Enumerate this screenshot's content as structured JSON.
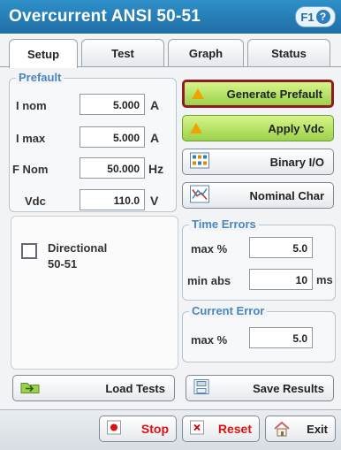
{
  "window": {
    "title": "Overcurrent ANSI 50-51",
    "help_label": "F1"
  },
  "tabs": [
    {
      "label": "Setup",
      "active": true
    },
    {
      "label": "Test",
      "active": false
    },
    {
      "label": "Graph",
      "active": false
    },
    {
      "label": "Status",
      "active": false
    }
  ],
  "prefault": {
    "legend": "Prefault",
    "rows": [
      {
        "label": "I nom",
        "value": "5.000",
        "unit": "A"
      },
      {
        "label": "I max",
        "value": "5.000",
        "unit": "A"
      },
      {
        "label": "F Nom",
        "value": "50.000",
        "unit": "Hz"
      },
      {
        "label": "Vdc",
        "value": "110.0",
        "unit": "V"
      }
    ]
  },
  "actions": {
    "generate_prefault": "Generate Prefault",
    "apply_vdc": "Apply Vdc",
    "binary_io": "Binary I/O",
    "nominal_char": "Nominal Char"
  },
  "directional": {
    "label_line1": "Directional",
    "label_line2": "50-51",
    "checked": false
  },
  "time_errors": {
    "legend": "Time Errors",
    "max_label": "max %",
    "max_value": "5.0",
    "min_label": "min abs",
    "min_value": "10",
    "min_unit": "ms"
  },
  "current_error": {
    "legend": "Current Error",
    "max_label": "max %",
    "max_value": "5.0"
  },
  "bottom": {
    "load_tests": "Load Tests",
    "save_results": "Save Results",
    "stop": "Stop",
    "reset": "Reset",
    "exit": "Exit"
  },
  "icons": {
    "warning": "warning-icon",
    "binary_io": "binary-io-icon",
    "nominal_char": "chart-icon",
    "load": "load-folder-icon",
    "save": "save-disk-icon",
    "stop": "stop-icon",
    "reset": "reset-icon",
    "exit": "home-icon"
  },
  "colors": {
    "title_bar": "#2f8fc8",
    "accent_green": "#9bd14a",
    "highlight_border": "#8c1d24",
    "legend_text": "#4a86c0"
  }
}
